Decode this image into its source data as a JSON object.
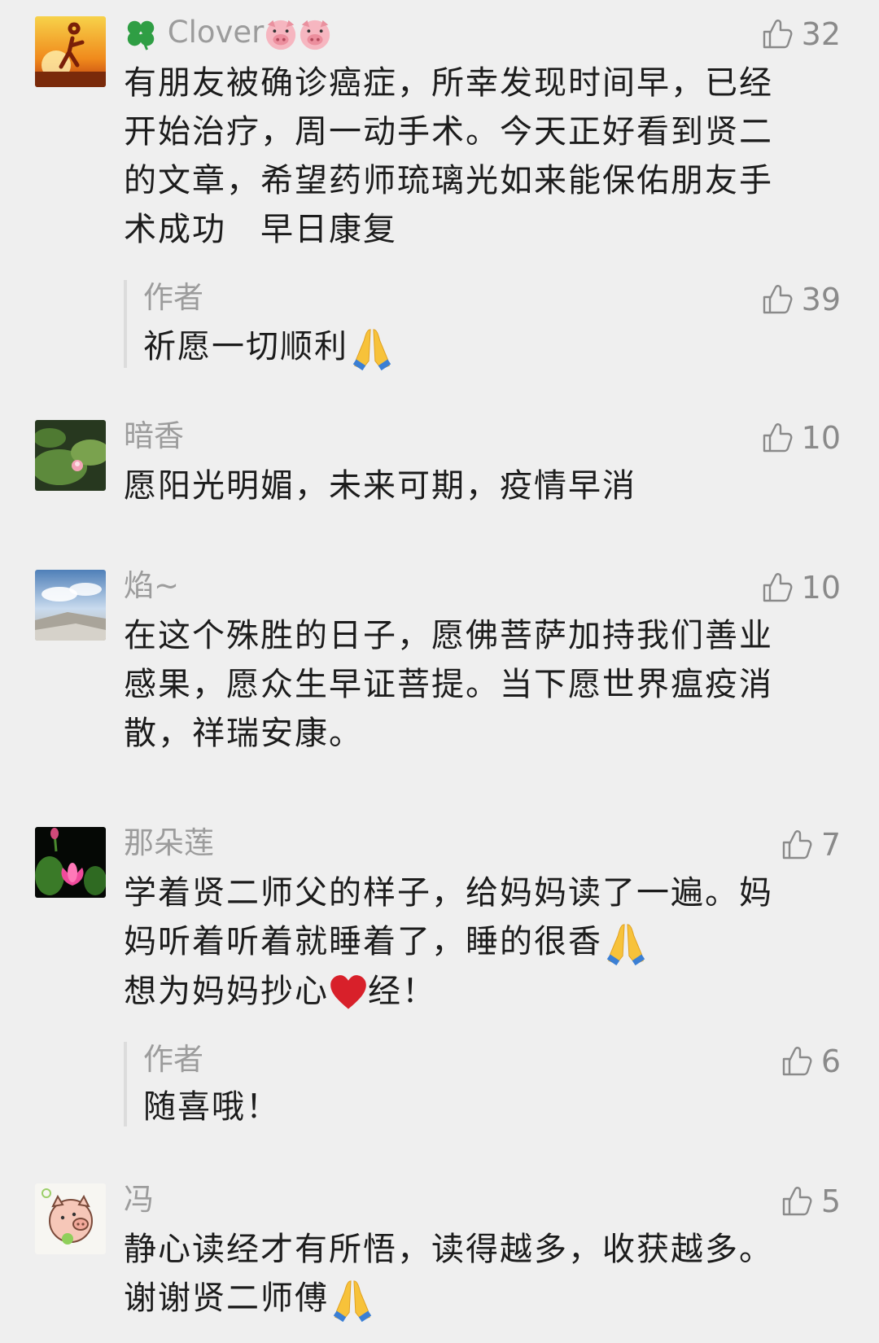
{
  "comments": [
    {
      "name": "Clover",
      "name_prefix_icon": "four-leaf-clover-icon",
      "name_suffix_icons": [
        "pig-face-icon",
        "pig-face-icon"
      ],
      "likes": "32",
      "lines": [
        "有朋友被确诊癌症，所幸发现时间早，已经",
        "开始治疗，周一动手术。今天正好看到贤二",
        "的文章，希望药师琉璃光如来能保佑朋友手",
        "术成功　早日康复"
      ],
      "reply": {
        "name": "作者",
        "likes": "39",
        "text": "祈愿一切顺利",
        "emoji": "folded-hands-icon"
      }
    },
    {
      "name": "暗香",
      "likes": "10",
      "lines": [
        "愿阳光明媚，未来可期，疫情早消"
      ]
    },
    {
      "name": "焰~",
      "likes": "10",
      "lines": [
        "在这个殊胜的日子，愿佛菩萨加持我们善业",
        "感果，愿众生早证菩提。当下愿世界瘟疫消",
        "散，祥瑞安康。"
      ]
    },
    {
      "name": "那朵莲",
      "likes": "7",
      "lines": [
        "学着贤二师父的样子，给妈妈读了一遍。妈",
        "妈听着听着就睡着了，睡的很香",
        "想为妈妈抄心",
        "经！"
      ],
      "reply": {
        "name": "作者",
        "likes": "6",
        "text": "随喜哦！"
      }
    },
    {
      "name": "冯",
      "likes": "5",
      "lines": [
        "静心读经才有所悟，读得越多，收获越多。",
        "谢谢贤二师傅"
      ]
    }
  ],
  "colors": {
    "background": "#efefef",
    "name_gray": "#9c9c9c",
    "like_gray": "#8a8a8a",
    "text": "#1c1c1c"
  }
}
